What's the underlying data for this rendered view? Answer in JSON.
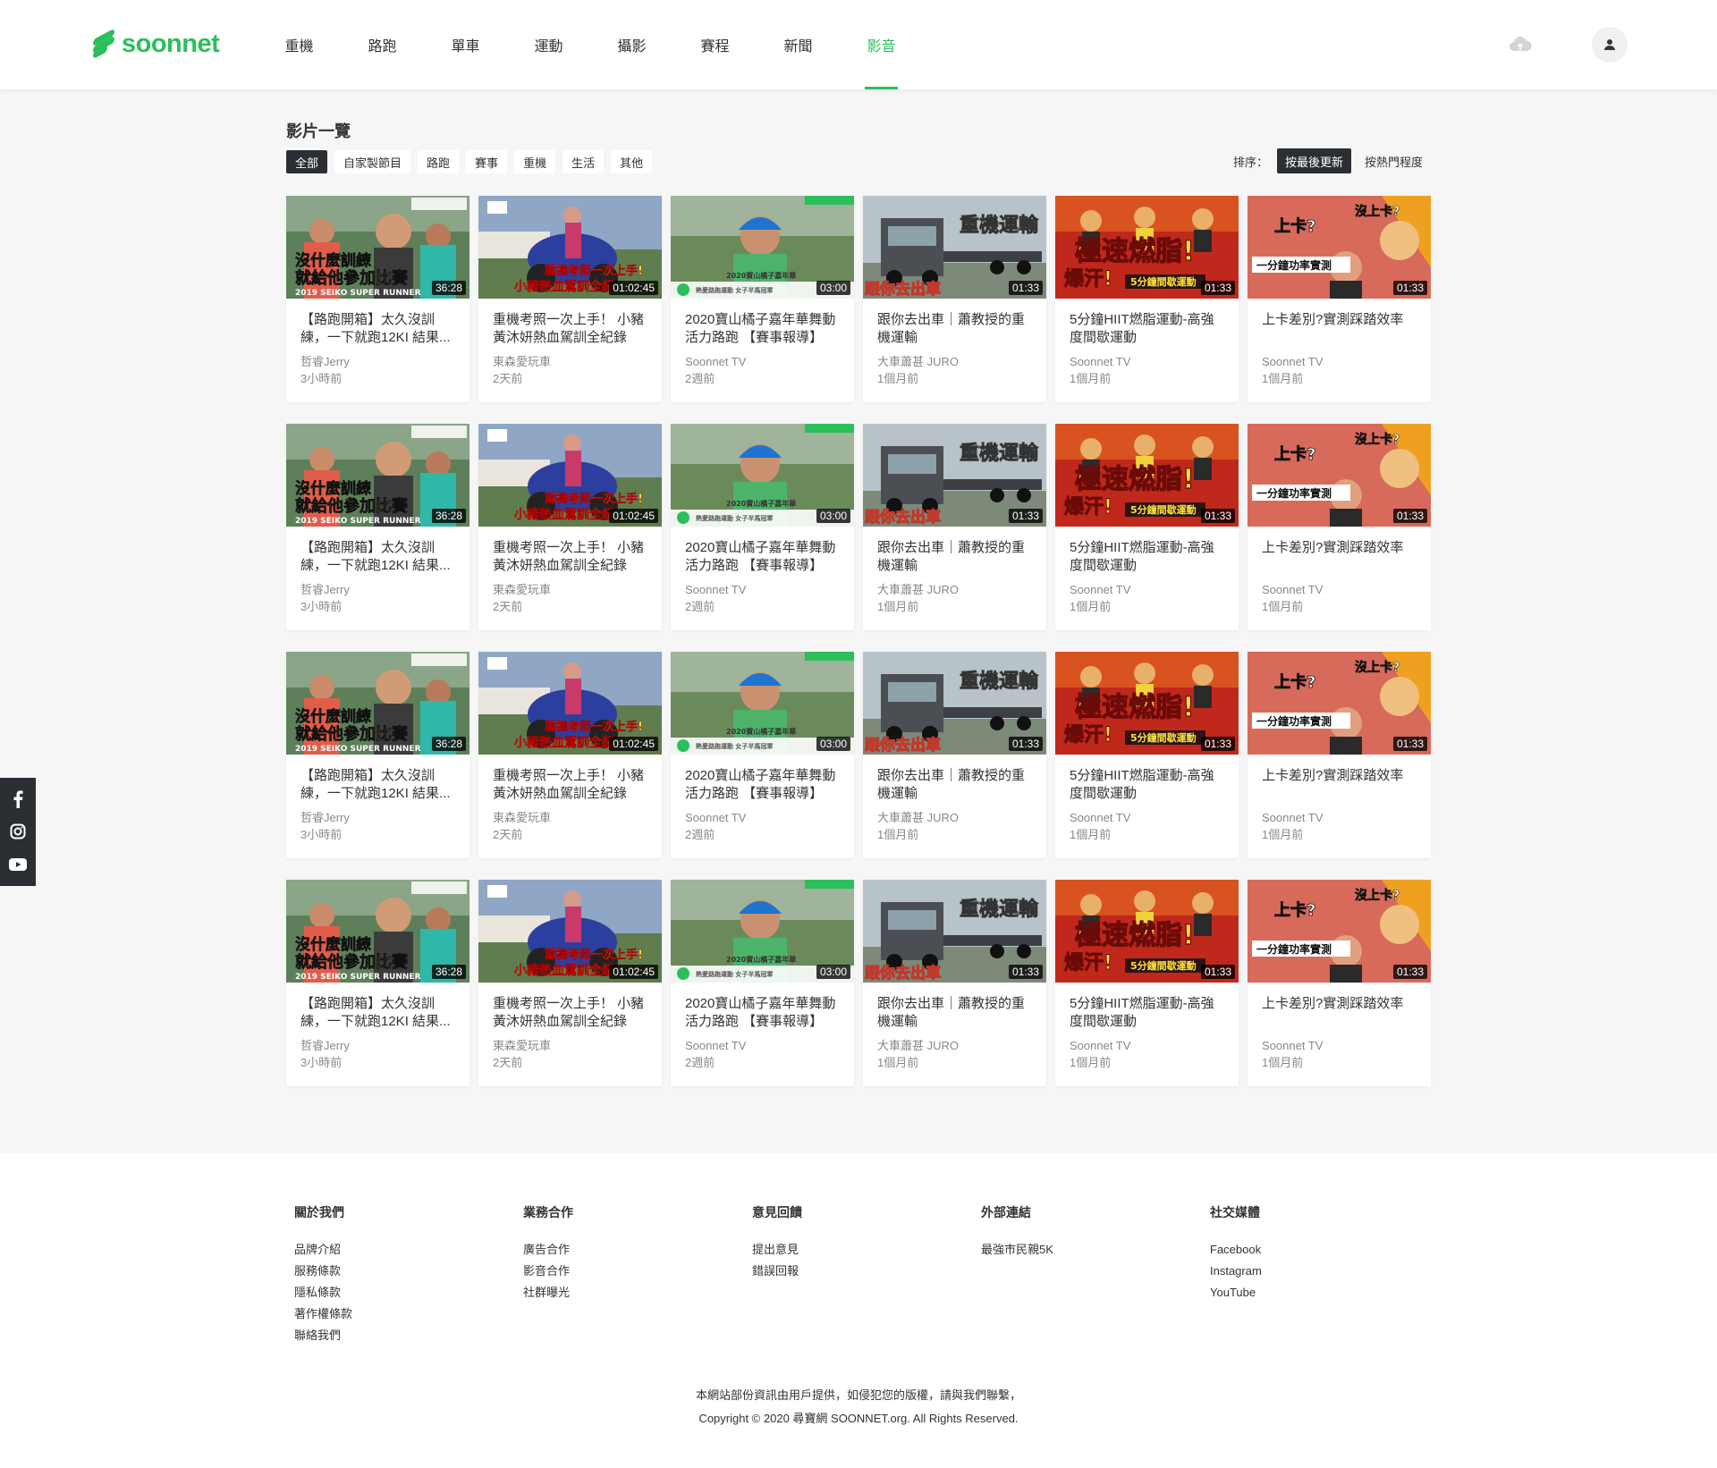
{
  "header": {
    "brand": "soonnet",
    "nav": [
      {
        "label": "重機",
        "name": "nav-item-heavy-bike",
        "active": false
      },
      {
        "label": "路跑",
        "name": "nav-item-running",
        "active": false
      },
      {
        "label": "單車",
        "name": "nav-item-cycling",
        "active": false
      },
      {
        "label": "運動",
        "name": "nav-item-sports",
        "active": false
      },
      {
        "label": "攝影",
        "name": "nav-item-photography",
        "active": false
      },
      {
        "label": "賽程",
        "name": "nav-item-schedule",
        "active": false
      },
      {
        "label": "新聞",
        "name": "nav-item-news",
        "active": false
      },
      {
        "label": "影音",
        "name": "nav-item-video",
        "active": true
      }
    ],
    "accent": "#2bbf5c"
  },
  "main": {
    "title": "影片一覽",
    "filters": [
      {
        "label": "全部",
        "active": true
      },
      {
        "label": "自家製節目",
        "active": false
      },
      {
        "label": "路跑",
        "active": false
      },
      {
        "label": "賽事",
        "active": false
      },
      {
        "label": "重機",
        "active": false
      },
      {
        "label": "生活",
        "active": false
      },
      {
        "label": "其他",
        "active": false
      }
    ],
    "sort": {
      "label": "排序：",
      "options": [
        {
          "label": "按最後更新",
          "active": true
        },
        {
          "label": "按熱門程度",
          "active": false
        }
      ]
    },
    "videos": [
      {
        "title": "【路跑開箱】太久沒訓練，一下就跑12KI 結果...",
        "author": "哲睿Jerry",
        "time": "3小時前",
        "duration": "36:28",
        "thumb": "runner",
        "caption1": "沒什麼訓練",
        "caption2": "就給他參加比賽",
        "caption3": "2019 SEIKO SUPER RUNNER"
      },
      {
        "title": "重機考照一次上手！ 小豬黃沐妍熱血駕訓全紀錄",
        "author": "東森愛玩車",
        "time": "2天前",
        "duration": "01:02:45",
        "thumb": "moto",
        "caption1": "重機考照一次上手!",
        "caption2": "小豬熱血駕訓全紀"
      },
      {
        "title": "2020寶山橘子嘉年華舞動活力路跑 【賽事報導】",
        "author": "Soonnet TV",
        "time": "2週前",
        "duration": "03:00",
        "thumb": "interview",
        "caption1": "2020寶山橘子嘉年華",
        "caption2": "熱愛路跑運動 女子半馬冠軍"
      },
      {
        "title": "跟你去出車｜蕭教授的重機運輸",
        "author": "大車蕭甚 JURO",
        "time": "1個月前",
        "duration": "01:33",
        "thumb": "truck",
        "caption1": "重機運輸",
        "caption2": "跟你去出車"
      },
      {
        "title": "5分鐘HIIT燃脂運動-高強度間歇運動",
        "author": "Soonnet TV",
        "time": "1個月前",
        "duration": "01:33",
        "thumb": "hiit",
        "caption1": "極速燃脂!",
        "caption2": "爆汗!",
        "caption3": "5分鐘間歇運動"
      },
      {
        "title": "上卡差別?實測踩踏效率",
        "author": "Soonnet TV",
        "time": "1個月前",
        "duration": "01:33",
        "thumb": "cleat",
        "caption1": "沒上卡?",
        "caption2": "上卡?",
        "caption3": "一分鐘功率實測"
      },
      {
        "title": "【路跑開箱】太久沒訓練，一下就跑12KI 結果...",
        "author": "哲睿Jerry",
        "time": "3小時前",
        "duration": "36:28",
        "thumb": "runner",
        "caption1": "沒什麼訓練",
        "caption2": "就給他參加比賽",
        "caption3": "2019 SEIKO SUPER RUNNER"
      },
      {
        "title": "重機考照一次上手！ 小豬黃沐妍熱血駕訓全紀錄",
        "author": "東森愛玩車",
        "time": "2天前",
        "duration": "01:02:45",
        "thumb": "moto",
        "caption1": "重機考照一次上手!",
        "caption2": "小豬熱血駕訓全紀"
      },
      {
        "title": "2020寶山橘子嘉年華舞動活力路跑 【賽事報導】",
        "author": "Soonnet TV",
        "time": "2週前",
        "duration": "03:00",
        "thumb": "interview",
        "caption1": "2020寶山橘子嘉年華",
        "caption2": "熱愛路跑運動 女子半馬冠軍"
      },
      {
        "title": "跟你去出車｜蕭教授的重機運輸",
        "author": "大車蕭甚 JURO",
        "time": "1個月前",
        "duration": "01:33",
        "thumb": "truck",
        "caption1": "重機運輸",
        "caption2": "跟你去出車"
      },
      {
        "title": "5分鐘HIIT燃脂運動-高強度間歇運動",
        "author": "Soonnet TV",
        "time": "1個月前",
        "duration": "01:33",
        "thumb": "hiit",
        "caption1": "極速燃脂!",
        "caption2": "爆汗!",
        "caption3": "5分鐘間歇運動"
      },
      {
        "title": "上卡差別?實測踩踏效率",
        "author": "Soonnet TV",
        "time": "1個月前",
        "duration": "01:33",
        "thumb": "cleat",
        "caption1": "沒上卡?",
        "caption2": "上卡?",
        "caption3": "一分鐘功率實測"
      },
      {
        "title": "【路跑開箱】太久沒訓練，一下就跑12KI 結果...",
        "author": "哲睿Jerry",
        "time": "3小時前",
        "duration": "36:28",
        "thumb": "runner",
        "caption1": "沒什麼訓練",
        "caption2": "就給他參加比賽",
        "caption3": "2019 SEIKO SUPER RUNNER"
      },
      {
        "title": "重機考照一次上手！ 小豬黃沐妍熱血駕訓全紀錄",
        "author": "東森愛玩車",
        "time": "2天前",
        "duration": "01:02:45",
        "thumb": "moto",
        "caption1": "重機考照一次上手!",
        "caption2": "小豬熱血駕訓全紀"
      },
      {
        "title": "2020寶山橘子嘉年華舞動活力路跑 【賽事報導】",
        "author": "Soonnet TV",
        "time": "2週前",
        "duration": "03:00",
        "thumb": "interview",
        "caption1": "2020寶山橘子嘉年華",
        "caption2": "熱愛路跑運動 女子半馬冠軍"
      },
      {
        "title": "跟你去出車｜蕭教授的重機運輸",
        "author": "大車蕭甚 JURO",
        "time": "1個月前",
        "duration": "01:33",
        "thumb": "truck",
        "caption1": "重機運輸",
        "caption2": "跟你去出車"
      },
      {
        "title": "5分鐘HIIT燃脂運動-高強度間歇運動",
        "author": "Soonnet TV",
        "time": "1個月前",
        "duration": "01:33",
        "thumb": "hiit",
        "caption1": "極速燃脂!",
        "caption2": "爆汗!",
        "caption3": "5分鐘間歇運動"
      },
      {
        "title": "上卡差別?實測踩踏效率",
        "author": "Soonnet TV",
        "time": "1個月前",
        "duration": "01:33",
        "thumb": "cleat",
        "caption1": "沒上卡?",
        "caption2": "上卡?",
        "caption3": "一分鐘功率實測"
      },
      {
        "title": "【路跑開箱】太久沒訓練，一下就跑12KI 結果...",
        "author": "哲睿Jerry",
        "time": "3小時前",
        "duration": "36:28",
        "thumb": "runner",
        "caption1": "沒什麼訓練",
        "caption2": "就給他參加比賽",
        "caption3": "2019 SEIKO SUPER RUNNER"
      },
      {
        "title": "重機考照一次上手！ 小豬黃沐妍熱血駕訓全紀錄",
        "author": "東森愛玩車",
        "time": "2天前",
        "duration": "01:02:45",
        "thumb": "moto",
        "caption1": "重機考照一次上手!",
        "caption2": "小豬熱血駕訓全紀"
      },
      {
        "title": "2020寶山橘子嘉年華舞動活力路跑 【賽事報導】",
        "author": "Soonnet TV",
        "time": "2週前",
        "duration": "03:00",
        "thumb": "interview",
        "caption1": "2020寶山橘子嘉年華",
        "caption2": "熱愛路跑運動 女子半馬冠軍"
      },
      {
        "title": "跟你去出車｜蕭教授的重機運輸",
        "author": "大車蕭甚 JURO",
        "time": "1個月前",
        "duration": "01:33",
        "thumb": "truck",
        "caption1": "重機運輸",
        "caption2": "跟你去出車"
      },
      {
        "title": "5分鐘HIIT燃脂運動-高強度間歇運動",
        "author": "Soonnet TV",
        "time": "1個月前",
        "duration": "01:33",
        "thumb": "hiit",
        "caption1": "極速燃脂!",
        "caption2": "爆汗!",
        "caption3": "5分鐘間歇運動"
      },
      {
        "title": "上卡差別?實測踩踏效率",
        "author": "Soonnet TV",
        "time": "1個月前",
        "duration": "01:33",
        "thumb": "cleat",
        "caption1": "沒上卡?",
        "caption2": "上卡?",
        "caption3": "一分鐘功率實測"
      }
    ]
  },
  "social_sidebar": [
    "facebook-icon",
    "instagram-icon",
    "youtube-icon"
  ],
  "footer": {
    "columns": [
      {
        "heading": "關於我們",
        "links": [
          "品牌介紹",
          "服務條款",
          "隱私條款",
          "著作權條款",
          "聯絡我們"
        ]
      },
      {
        "heading": "業務合作",
        "links": [
          "廣告合作",
          "影音合作",
          "社群曝光"
        ]
      },
      {
        "heading": "意見回饋",
        "links": [
          "提出意見",
          "錯誤回報"
        ]
      },
      {
        "heading": "外部連結",
        "links": [
          "最強市民親5K"
        ]
      },
      {
        "heading": "社交媒體",
        "links": [
          "Facebook",
          "Instagram",
          "YouTube"
        ]
      }
    ],
    "notice": "本網站部份資訊由用戶提供，如侵犯您的版權，請與我們聯繫，",
    "copyright": "Copyright © 2020 尋寶網 SOONNET.org. All Rights Reserved."
  }
}
